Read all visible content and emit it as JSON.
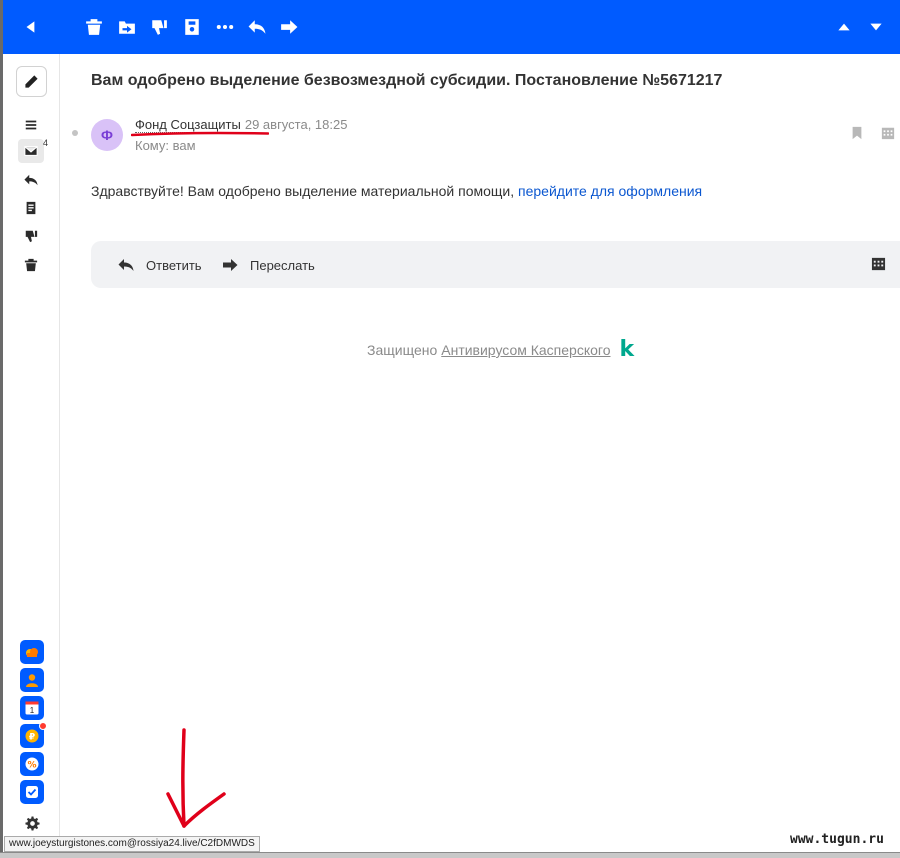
{
  "toolbar": {
    "back": "back-icon",
    "actions": [
      "trash-icon",
      "move-to-folder-icon",
      "spam-icon",
      "archive-icon",
      "more-icon",
      "reply-icon",
      "forward-icon"
    ],
    "nav_up": "chevron-up-icon",
    "nav_down": "chevron-down-icon",
    "accent": "#005bff"
  },
  "sidebar": {
    "compose": "pencil-icon",
    "items": [
      {
        "icon": "menu-icon"
      },
      {
        "icon": "inbox-icon",
        "badge": "4",
        "active": true
      },
      {
        "icon": "sent-icon"
      },
      {
        "icon": "drafts-icon"
      },
      {
        "icon": "spam-icon"
      },
      {
        "icon": "trash-icon"
      }
    ],
    "apps": [
      "cloud-icon",
      "contacts-icon",
      "calendar-icon",
      "money-icon",
      "discount-icon",
      "tasks-icon"
    ],
    "calendar_day": "1",
    "settings": "gear-icon"
  },
  "email": {
    "subject": "Вам одобрено выделение безвозмездной субсидии. Постановление №5671217",
    "avatar_letter": "Ф",
    "avatar_color": "#d9c2f7",
    "sender_name": "Фонд Соцзащиты",
    "date": "29 августа, 18:25",
    "recipient": "Кому: вам",
    "body_text": "Здравствуйте! Вам одобрено выделение материальной помощи, ",
    "body_link": "перейдите для оформления",
    "link_color": "#0b57d0"
  },
  "reply_bar": {
    "reply_label": "Ответить",
    "forward_label": "Переслать"
  },
  "protection": {
    "prefix": "Защищено",
    "link": "Антивирусом Касперского",
    "logo": "k",
    "logo_color": "#00a88e"
  },
  "status_url": "www.joeysturgistones.com@rossiya24.live/C2fDMWDS",
  "watermark": "www.tugun.ru",
  "annotation_color": "#e0001a"
}
